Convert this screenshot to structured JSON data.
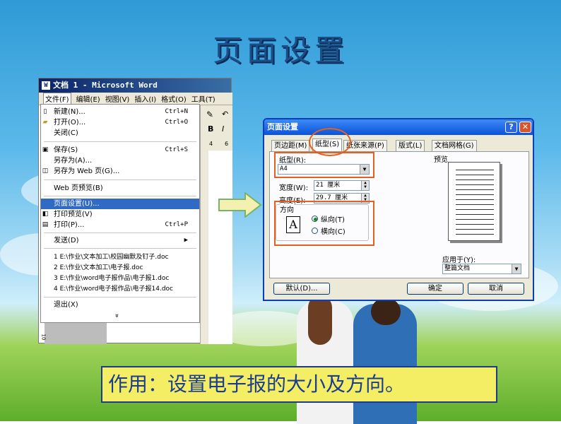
{
  "slide_title": "页面设置",
  "caption": "作用：设置电子报的大小及方向。",
  "word_window": {
    "title": "文档 1 - Microsoft Word",
    "menus": [
      "文件(F)",
      "编辑(E)",
      "视图(V)",
      "插入(I)",
      "格式(O)",
      "工具(T)"
    ],
    "format_buttons": [
      "B",
      "I"
    ],
    "ruler": [
      "4",
      "6"
    ],
    "file_menu": [
      {
        "label": "新建(N)...",
        "shortcut": "Ctrl+N",
        "icon": "new-doc-icon"
      },
      {
        "label": "打开(O)...",
        "shortcut": "Ctrl+O",
        "icon": "open-folder-icon"
      },
      {
        "label": "关闭(C)",
        "shortcut": "",
        "icon": ""
      },
      {
        "label": "保存(S)",
        "shortcut": "Ctrl+S",
        "icon": "save-icon"
      },
      {
        "label": "另存为(A)...",
        "shortcut": "",
        "icon": ""
      },
      {
        "label": "另存为 Web 页(G)...",
        "shortcut": "",
        "icon": "web-page-icon"
      },
      {
        "label": "Web 页预览(B)",
        "shortcut": "",
        "icon": ""
      },
      {
        "label": "页面设置(U)...",
        "shortcut": "",
        "icon": "",
        "highlighted": true
      },
      {
        "label": "打印预览(V)",
        "shortcut": "",
        "icon": "print-preview-icon"
      },
      {
        "label": "打印(P)...",
        "shortcut": "Ctrl+P",
        "icon": "print-icon"
      },
      {
        "label": "发送(D)",
        "shortcut": "▶",
        "icon": ""
      },
      {
        "label": "1 E:\\作业\\文本加工\\校园幽默及钉子.doc",
        "shortcut": "",
        "icon": ""
      },
      {
        "label": "2 E:\\作业\\文本加工\\电子报.doc",
        "shortcut": "",
        "icon": ""
      },
      {
        "label": "3 E:\\作业\\word电子报作品\\电子报1.doc",
        "shortcut": "",
        "icon": ""
      },
      {
        "label": "4 E:\\作业\\word电子报作品\\电子报14.doc",
        "shortcut": "",
        "icon": ""
      },
      {
        "label": "退出(X)",
        "shortcut": "",
        "icon": ""
      }
    ],
    "expand_arrow": "»",
    "side_ruler": "10"
  },
  "dialog": {
    "title": "页面设置",
    "help": "?",
    "close": "✕",
    "tabs": [
      "页边距(M)",
      "纸型(S)",
      "纸张来源(P)",
      "版式(L)",
      "文档网格(G)"
    ],
    "paper_size_label": "纸型(R):",
    "paper_size_value": "A4",
    "width_label": "宽度(W):",
    "width_value": "21 厘米",
    "height_label": "高度(E):",
    "height_value": "29.7 厘米",
    "orientation_label": "方向",
    "orientation_icon": "A",
    "portrait": "纵向(T)",
    "landscape": "横向(C)",
    "preview_label": "预览",
    "apply_label": "应用于(Y):",
    "apply_value": "整篇文档",
    "default_button": "默认(D)...",
    "ok_button": "确定",
    "cancel_button": "取消"
  }
}
